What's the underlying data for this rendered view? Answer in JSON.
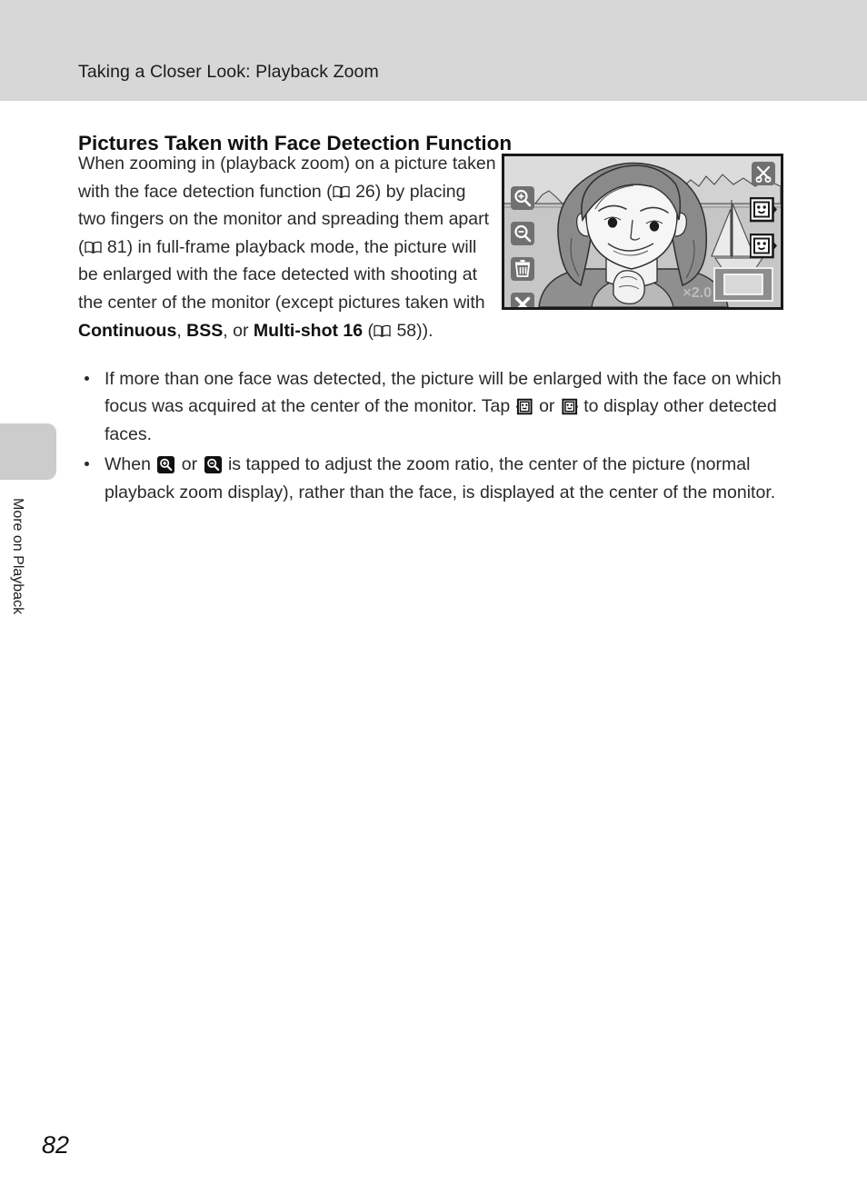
{
  "header": {
    "title": "Taking a Closer Look: Playback Zoom"
  },
  "side_tab": {
    "label": "More on Playback"
  },
  "section": {
    "heading": "Pictures Taken with Face Detection Function"
  },
  "intro": {
    "p1": "When zooming in (playback zoom) on a picture taken with the face detection function (",
    "ref1": " 26) by placing two fingers on the monitor and spreading them apart (",
    "ref2": " 81) in full-frame playback mode, the picture will be enlarged with the face detected with shooting at the center of the monitor (except pictures taken with ",
    "term1": "Continuous",
    "sep1": ", ",
    "term2": "BSS",
    "sep2": ", or ",
    "term3": "Multi-shot 16",
    "ref3_open": " (",
    "ref3": " 58)).",
    "page_ref_26": "26",
    "page_ref_81": "81",
    "page_ref_58": "58"
  },
  "bullets": [
    {
      "part1": "If more than one face was detected, the picture will be enlarged with the face on which focus was acquired at the center of the monitor. Tap ",
      "icon1": "face-select-previous-icon",
      "part2": " or ",
      "icon2": "face-select-next-icon",
      "part3": " to display other detected faces."
    },
    {
      "part1": "When ",
      "icon1": "zoom-in-icon",
      "part2": " or ",
      "icon2": "zoom-out-icon",
      "part3": " is tapped to adjust the zoom ratio, the center of the picture (normal playback zoom display), rather than the face, is displayed at the center of the monitor."
    }
  ],
  "monitor": {
    "zoom_ratio_label": "×2.0",
    "controls_left": [
      "zoom-in-icon",
      "zoom-out-icon",
      "trash-icon",
      "cancel-icon"
    ],
    "controls_right": [
      "scissors-crop-icon",
      "face-select-previous-icon",
      "face-select-next-icon"
    ],
    "thumbnail_indicator": "navigation-thumbnail"
  },
  "footer": {
    "page_number": "82"
  },
  "colors": {
    "header_band": "#d7d7d7",
    "side_tab": "#cccccc",
    "monitor_border": "#1a1a1a",
    "monitor_bg": "#c9c9c9",
    "icon_button_bg": "#6f6f6f",
    "text": "#2a2a2a"
  }
}
